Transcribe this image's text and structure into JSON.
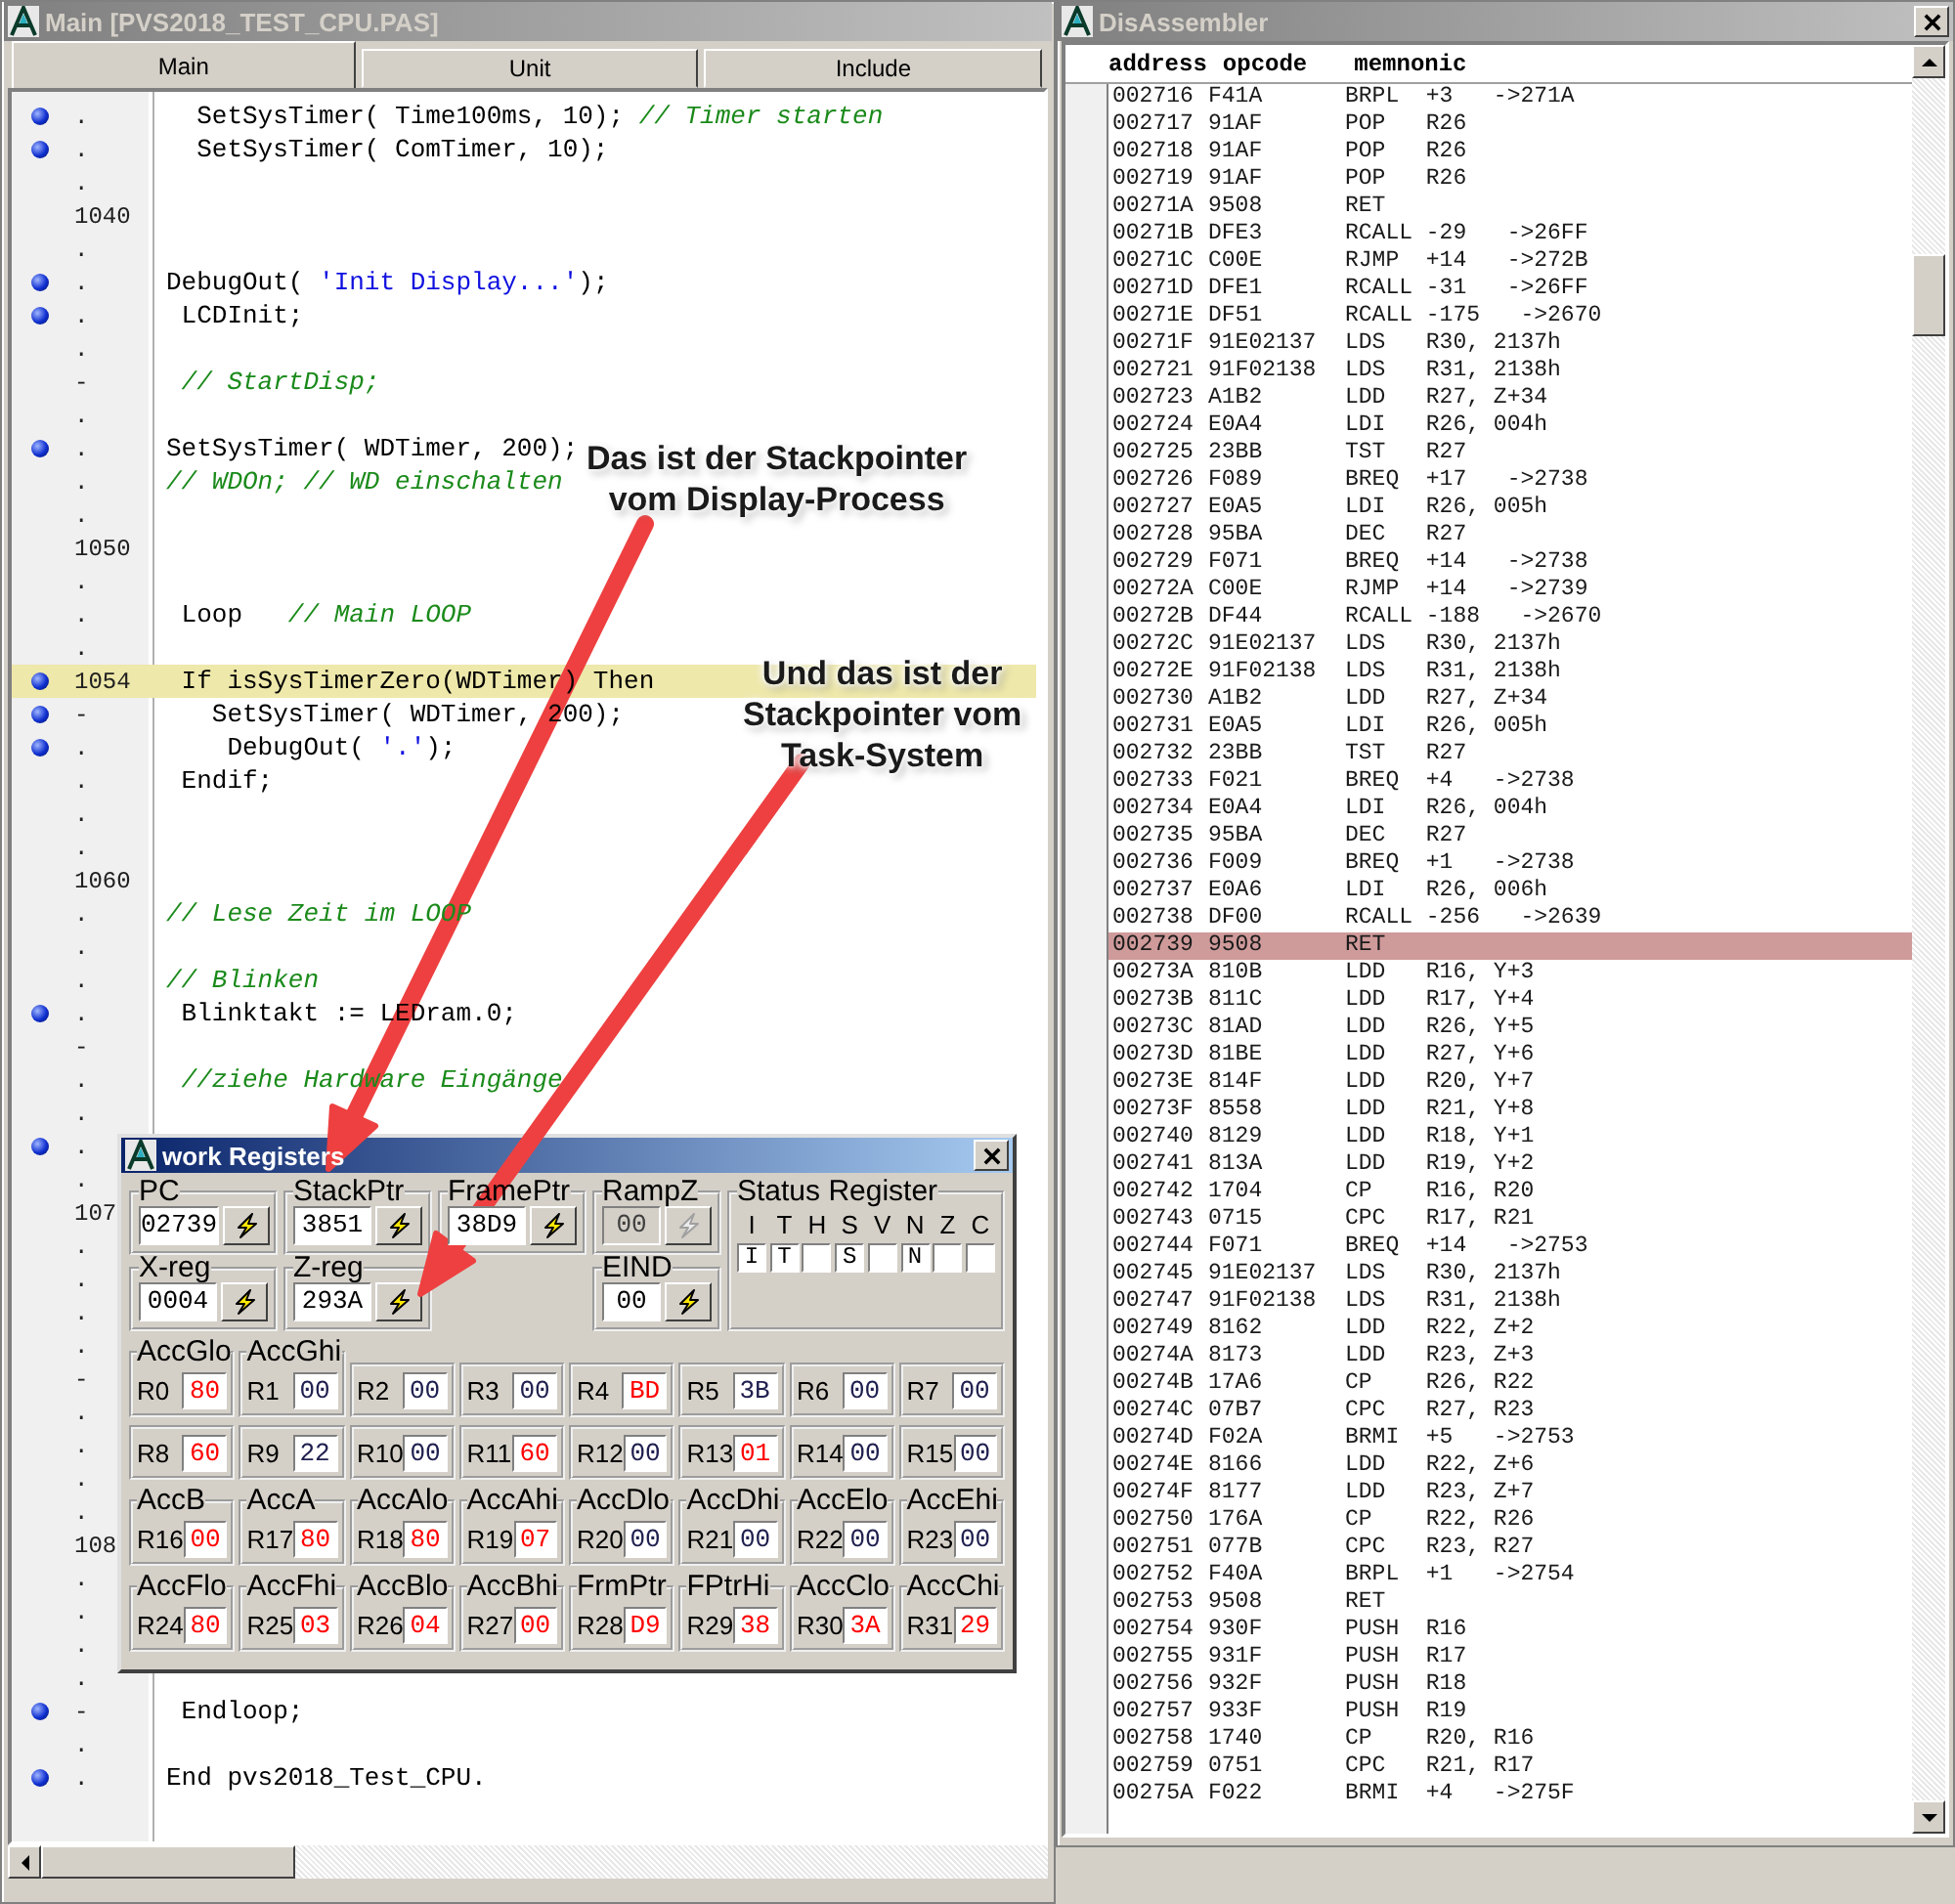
{
  "editor_window": {
    "title": "Main [PVS2018_TEST_CPU.PAS]",
    "tabs": [
      {
        "label": "Main",
        "selected": true
      },
      {
        "label": "Unit",
        "selected": false
      },
      {
        "label": "Include",
        "selected": false
      }
    ],
    "lines": [
      {
        "breakpoint": true,
        "gutter": ".",
        "current": false,
        "code": [
          {
            "kind": "code",
            "text": "  SetSysTimer( Time100ms, 10); "
          },
          {
            "kind": "comment",
            "text": "// Timer starten"
          }
        ]
      },
      {
        "breakpoint": true,
        "gutter": ".",
        "current": false,
        "code": [
          {
            "kind": "code",
            "text": "  SetSysTimer( ComTimer, 10);"
          }
        ]
      },
      {
        "breakpoint": false,
        "gutter": ".",
        "current": false
      },
      {
        "breakpoint": false,
        "gutter": "1040",
        "current": false
      },
      {
        "breakpoint": false,
        "gutter": ".",
        "current": false
      },
      {
        "breakpoint": true,
        "gutter": ".",
        "current": false,
        "code": [
          {
            "kind": "code",
            "text": "DebugOut( "
          },
          {
            "kind": "string",
            "text": "'Init Display...'"
          },
          {
            "kind": "code",
            "text": ");"
          }
        ]
      },
      {
        "breakpoint": true,
        "gutter": ".",
        "current": false,
        "code": [
          {
            "kind": "code",
            "text": " LCDInit;"
          }
        ]
      },
      {
        "breakpoint": false,
        "gutter": ".",
        "current": false
      },
      {
        "breakpoint": false,
        "gutter": "-",
        "current": false,
        "code": [
          {
            "kind": "comment",
            "text": " // StartDisp;"
          }
        ]
      },
      {
        "breakpoint": false,
        "gutter": ".",
        "current": false
      },
      {
        "breakpoint": true,
        "gutter": ".",
        "current": false,
        "code": [
          {
            "kind": "code",
            "text": "SetSysTimer( WDTimer, 200);"
          }
        ]
      },
      {
        "breakpoint": false,
        "gutter": ".",
        "current": false,
        "code": [
          {
            "kind": "comment",
            "text": "// WDOn; // WD einschalten"
          }
        ]
      },
      {
        "breakpoint": false,
        "gutter": ".",
        "current": false
      },
      {
        "breakpoint": false,
        "gutter": "1050",
        "current": false
      },
      {
        "breakpoint": false,
        "gutter": ".",
        "current": false
      },
      {
        "breakpoint": false,
        "gutter": ".",
        "current": false,
        "code": [
          {
            "kind": "code",
            "text": " Loop   "
          },
          {
            "kind": "comment",
            "text": "// Main LOOP"
          }
        ]
      },
      {
        "breakpoint": false,
        "gutter": ".",
        "current": false
      },
      {
        "breakpoint": true,
        "gutter": "1054",
        "current": true,
        "code": [
          {
            "kind": "code",
            "text": " If isSysTimerZero(WDTimer) Then"
          }
        ]
      },
      {
        "breakpoint": true,
        "gutter": "-",
        "current": false,
        "code": [
          {
            "kind": "code",
            "text": "   SetSysTimer( WDTimer, 200);"
          }
        ]
      },
      {
        "breakpoint": true,
        "gutter": ".",
        "current": false,
        "code": [
          {
            "kind": "code",
            "text": "    DebugOut( "
          },
          {
            "kind": "string",
            "text": "'.'"
          },
          {
            "kind": "code",
            "text": ");"
          }
        ]
      },
      {
        "breakpoint": false,
        "gutter": ".",
        "current": false,
        "code": [
          {
            "kind": "code",
            "text": " Endif;"
          }
        ]
      },
      {
        "breakpoint": false,
        "gutter": ".",
        "current": false
      },
      {
        "breakpoint": false,
        "gutter": ".",
        "current": false
      },
      {
        "breakpoint": false,
        "gutter": "1060",
        "current": false
      },
      {
        "breakpoint": false,
        "gutter": ".",
        "current": false,
        "code": [
          {
            "kind": "comment",
            "text": "// Lese Zeit im LOOP"
          }
        ]
      },
      {
        "breakpoint": false,
        "gutter": ".",
        "current": false
      },
      {
        "breakpoint": false,
        "gutter": ".",
        "current": false,
        "code": [
          {
            "kind": "comment",
            "text": "// Blinken"
          }
        ]
      },
      {
        "breakpoint": true,
        "gutter": ".",
        "current": false,
        "code": [
          {
            "kind": "code",
            "text": " Blinktakt := LEDram.0;"
          }
        ]
      },
      {
        "breakpoint": false,
        "gutter": "-",
        "current": false
      },
      {
        "breakpoint": false,
        "gutter": ".",
        "current": false,
        "code": [
          {
            "kind": "comment",
            "text": " //ziehe Hardware Eingänge"
          }
        ]
      },
      {
        "breakpoint": false,
        "gutter": ".",
        "current": false
      },
      {
        "breakpoint": true,
        "gutter": ".",
        "current": false
      },
      {
        "breakpoint": false,
        "gutter": ".",
        "current": false
      },
      {
        "breakpoint": false,
        "gutter": "107",
        "current": false
      },
      {
        "breakpoint": false,
        "gutter": ".",
        "current": false
      },
      {
        "breakpoint": false,
        "gutter": ".",
        "current": false
      },
      {
        "breakpoint": false,
        "gutter": ".",
        "current": false
      },
      {
        "breakpoint": false,
        "gutter": ".",
        "current": false
      },
      {
        "breakpoint": false,
        "gutter": "-",
        "current": false
      },
      {
        "breakpoint": false,
        "gutter": ".",
        "current": false
      },
      {
        "breakpoint": false,
        "gutter": ".",
        "current": false
      },
      {
        "breakpoint": false,
        "gutter": ".",
        "current": false
      },
      {
        "breakpoint": false,
        "gutter": ".",
        "current": false
      },
      {
        "breakpoint": false,
        "gutter": "108",
        "current": false
      },
      {
        "breakpoint": false,
        "gutter": ".",
        "current": false
      },
      {
        "breakpoint": false,
        "gutter": ".",
        "current": false
      },
      {
        "breakpoint": false,
        "gutter": ".",
        "current": false
      },
      {
        "breakpoint": false,
        "gutter": ".",
        "current": false
      },
      {
        "breakpoint": true,
        "gutter": "-",
        "current": false,
        "code": [
          {
            "kind": "code",
            "text": " Endloop;"
          }
        ]
      },
      {
        "breakpoint": false,
        "gutter": ".",
        "current": false
      },
      {
        "breakpoint": true,
        "gutter": ".",
        "current": false,
        "code": [
          {
            "kind": "code",
            "text": "End pvs2018_Test_CPU."
          }
        ]
      }
    ]
  },
  "disassembler_window": {
    "title": "DisAssembler",
    "columns": [
      "address",
      "opcode",
      "memnonic"
    ],
    "rows": [
      {
        "address": "002716",
        "opcode": "F41A",
        "mnemonic": "BRPL  +3   ->271A",
        "selected": false
      },
      {
        "address": "002717",
        "opcode": "91AF",
        "mnemonic": "POP   R26",
        "selected": false
      },
      {
        "address": "002718",
        "opcode": "91AF",
        "mnemonic": "POP   R26",
        "selected": false
      },
      {
        "address": "002719",
        "opcode": "91AF",
        "mnemonic": "POP   R26",
        "selected": false
      },
      {
        "address": "00271A",
        "opcode": "9508",
        "mnemonic": "RET",
        "selected": false
      },
      {
        "address": "00271B",
        "opcode": "DFE3",
        "mnemonic": "RCALL -29   ->26FF",
        "selected": false
      },
      {
        "address": "00271C",
        "opcode": "C00E",
        "mnemonic": "RJMP  +14   ->272B",
        "selected": false
      },
      {
        "address": "00271D",
        "opcode": "DFE1",
        "mnemonic": "RCALL -31   ->26FF",
        "selected": false
      },
      {
        "address": "00271E",
        "opcode": "DF51",
        "mnemonic": "RCALL -175   ->2670",
        "selected": false
      },
      {
        "address": "00271F",
        "opcode": "91E02137",
        "mnemonic": "LDS   R30, 2137h",
        "selected": false
      },
      {
        "address": "002721",
        "opcode": "91F02138",
        "mnemonic": "LDS   R31, 2138h",
        "selected": false
      },
      {
        "address": "002723",
        "opcode": "A1B2",
        "mnemonic": "LDD   R27, Z+34",
        "selected": false
      },
      {
        "address": "002724",
        "opcode": "E0A4",
        "mnemonic": "LDI   R26, 004h",
        "selected": false
      },
      {
        "address": "002725",
        "opcode": "23BB",
        "mnemonic": "TST   R27",
        "selected": false
      },
      {
        "address": "002726",
        "opcode": "F089",
        "mnemonic": "BREQ  +17   ->2738",
        "selected": false
      },
      {
        "address": "002727",
        "opcode": "E0A5",
        "mnemonic": "LDI   R26, 005h",
        "selected": false
      },
      {
        "address": "002728",
        "opcode": "95BA",
        "mnemonic": "DEC   R27",
        "selected": false
      },
      {
        "address": "002729",
        "opcode": "F071",
        "mnemonic": "BREQ  +14   ->2738",
        "selected": false
      },
      {
        "address": "00272A",
        "opcode": "C00E",
        "mnemonic": "RJMP  +14   ->2739",
        "selected": false
      },
      {
        "address": "00272B",
        "opcode": "DF44",
        "mnemonic": "RCALL -188   ->2670",
        "selected": false
      },
      {
        "address": "00272C",
        "opcode": "91E02137",
        "mnemonic": "LDS   R30, 2137h",
        "selected": false
      },
      {
        "address": "00272E",
        "opcode": "91F02138",
        "mnemonic": "LDS   R31, 2138h",
        "selected": false
      },
      {
        "address": "002730",
        "opcode": "A1B2",
        "mnemonic": "LDD   R27, Z+34",
        "selected": false
      },
      {
        "address": "002731",
        "opcode": "E0A5",
        "mnemonic": "LDI   R26, 005h",
        "selected": false
      },
      {
        "address": "002732",
        "opcode": "23BB",
        "mnemonic": "TST   R27",
        "selected": false
      },
      {
        "address": "002733",
        "opcode": "F021",
        "mnemonic": "BREQ  +4   ->2738",
        "selected": false
      },
      {
        "address": "002734",
        "opcode": "E0A4",
        "mnemonic": "LDI   R26, 004h",
        "selected": false
      },
      {
        "address": "002735",
        "opcode": "95BA",
        "mnemonic": "DEC   R27",
        "selected": false
      },
      {
        "address": "002736",
        "opcode": "F009",
        "mnemonic": "BREQ  +1   ->2738",
        "selected": false
      },
      {
        "address": "002737",
        "opcode": "E0A6",
        "mnemonic": "LDI   R26, 006h",
        "selected": false
      },
      {
        "address": "002738",
        "opcode": "DF00",
        "mnemonic": "RCALL -256   ->2639",
        "selected": false
      },
      {
        "address": "002739",
        "opcode": "9508",
        "mnemonic": "RET",
        "selected": true
      },
      {
        "address": "00273A",
        "opcode": "810B",
        "mnemonic": "LDD   R16, Y+3",
        "selected": false
      },
      {
        "address": "00273B",
        "opcode": "811C",
        "mnemonic": "LDD   R17, Y+4",
        "selected": false
      },
      {
        "address": "00273C",
        "opcode": "81AD",
        "mnemonic": "LDD   R26, Y+5",
        "selected": false
      },
      {
        "address": "00273D",
        "opcode": "81BE",
        "mnemonic": "LDD   R27, Y+6",
        "selected": false
      },
      {
        "address": "00273E",
        "opcode": "814F",
        "mnemonic": "LDD   R20, Y+7",
        "selected": false
      },
      {
        "address": "00273F",
        "opcode": "8558",
        "mnemonic": "LDD   R21, Y+8",
        "selected": false
      },
      {
        "address": "002740",
        "opcode": "8129",
        "mnemonic": "LDD   R18, Y+1",
        "selected": false
      },
      {
        "address": "002741",
        "opcode": "813A",
        "mnemonic": "LDD   R19, Y+2",
        "selected": false
      },
      {
        "address": "002742",
        "opcode": "1704",
        "mnemonic": "CP    R16, R20",
        "selected": false
      },
      {
        "address": "002743",
        "opcode": "0715",
        "mnemonic": "CPC   R17, R21",
        "selected": false
      },
      {
        "address": "002744",
        "opcode": "F071",
        "mnemonic": "BREQ  +14   ->2753",
        "selected": false
      },
      {
        "address": "002745",
        "opcode": "91E02137",
        "mnemonic": "LDS   R30, 2137h",
        "selected": false
      },
      {
        "address": "002747",
        "opcode": "91F02138",
        "mnemonic": "LDS   R31, 2138h",
        "selected": false
      },
      {
        "address": "002749",
        "opcode": "8162",
        "mnemonic": "LDD   R22, Z+2",
        "selected": false
      },
      {
        "address": "00274A",
        "opcode": "8173",
        "mnemonic": "LDD   R23, Z+3",
        "selected": false
      },
      {
        "address": "00274B",
        "opcode": "17A6",
        "mnemonic": "CP    R26, R22",
        "selected": false
      },
      {
        "address": "00274C",
        "opcode": "07B7",
        "mnemonic": "CPC   R27, R23",
        "selected": false
      },
      {
        "address": "00274D",
        "opcode": "F02A",
        "mnemonic": "BRMI  +5   ->2753",
        "selected": false
      },
      {
        "address": "00274E",
        "opcode": "8166",
        "mnemonic": "LDD   R22, Z+6",
        "selected": false
      },
      {
        "address": "00274F",
        "opcode": "8177",
        "mnemonic": "LDD   R23, Z+7",
        "selected": false
      },
      {
        "address": "002750",
        "opcode": "176A",
        "mnemonic": "CP    R22, R26",
        "selected": false
      },
      {
        "address": "002751",
        "opcode": "077B",
        "mnemonic": "CPC   R23, R27",
        "selected": false
      },
      {
        "address": "002752",
        "opcode": "F40A",
        "mnemonic": "BRPL  +1   ->2754",
        "selected": false
      },
      {
        "address": "002753",
        "opcode": "9508",
        "mnemonic": "RET",
        "selected": false
      },
      {
        "address": "002754",
        "opcode": "930F",
        "mnemonic": "PUSH  R16",
        "selected": false
      },
      {
        "address": "002755",
        "opcode": "931F",
        "mnemonic": "PUSH  R17",
        "selected": false
      },
      {
        "address": "002756",
        "opcode": "932F",
        "mnemonic": "PUSH  R18",
        "selected": false
      },
      {
        "address": "002757",
        "opcode": "933F",
        "mnemonic": "PUSH  R19",
        "selected": false
      },
      {
        "address": "002758",
        "opcode": "1740",
        "mnemonic": "CP    R20, R16",
        "selected": false
      },
      {
        "address": "002759",
        "opcode": "0751",
        "mnemonic": "CPC   R21, R17",
        "selected": false
      },
      {
        "address": "00275A",
        "opcode": "F022",
        "mnemonic": "BRMI  +4   ->275F",
        "selected": false
      }
    ]
  },
  "registers_window": {
    "title": "work Registers",
    "pointer_rows": [
      [
        {
          "label": "PC",
          "value": "02739",
          "enabled": true
        },
        {
          "label": "StackPtr",
          "value": "3851",
          "enabled": true
        },
        {
          "label": "FramePtr",
          "value": "38D9",
          "enabled": true
        },
        {
          "label": "RampZ",
          "value": "00",
          "enabled": false
        }
      ],
      [
        {
          "label": "X-reg",
          "value": "0004",
          "enabled": true
        },
        {
          "label": "Z-reg",
          "value": "293A",
          "enabled": true
        },
        {
          "label": "EIND",
          "value": "00",
          "enabled": true
        }
      ]
    ],
    "status_register": {
      "title": "Status Register",
      "flags": [
        {
          "label": "I",
          "box_text": "I"
        },
        {
          "label": "T",
          "box_text": "T"
        },
        {
          "label": "H"
        },
        {
          "label": "S",
          "box_text": "S"
        },
        {
          "label": "V"
        },
        {
          "label": "N",
          "box_text": "N"
        },
        {
          "label": "Z"
        },
        {
          "label": "C"
        }
      ]
    },
    "registers": [
      {
        "alias": "AccGlo",
        "name": "R0",
        "value": "80",
        "changed": true
      },
      {
        "alias": "AccGhi",
        "name": "R1",
        "value": "00",
        "changed": false
      },
      {
        "name": "R2",
        "value": "00",
        "changed": false
      },
      {
        "name": "R3",
        "value": "00",
        "changed": false
      },
      {
        "name": "R4",
        "value": "BD",
        "changed": true
      },
      {
        "name": "R5",
        "value": "3B",
        "changed": false
      },
      {
        "name": "R6",
        "value": "00",
        "changed": false
      },
      {
        "name": "R7",
        "value": "00",
        "changed": false
      },
      {
        "name": "R8",
        "value": "60",
        "changed": true
      },
      {
        "name": "R9",
        "value": "22",
        "changed": false
      },
      {
        "name": "R10",
        "value": "00",
        "changed": false
      },
      {
        "name": "R11",
        "value": "60",
        "changed": true
      },
      {
        "name": "R12",
        "value": "00",
        "changed": false
      },
      {
        "name": "R13",
        "value": "01",
        "changed": true
      },
      {
        "name": "R14",
        "value": "00",
        "changed": false
      },
      {
        "name": "R15",
        "value": "00",
        "changed": false
      },
      {
        "alias": "AccB",
        "name": "R16",
        "value": "00",
        "changed": true
      },
      {
        "alias": "AccA",
        "name": "R17",
        "value": "80",
        "changed": true
      },
      {
        "alias": "AccAlo",
        "name": "R18",
        "value": "80",
        "changed": true
      },
      {
        "alias": "AccAhi",
        "name": "R19",
        "value": "07",
        "changed": true
      },
      {
        "alias": "AccDlo",
        "name": "R20",
        "value": "00",
        "changed": false
      },
      {
        "alias": "AccDhi",
        "name": "R21",
        "value": "00",
        "changed": false
      },
      {
        "alias": "AccElo",
        "name": "R22",
        "value": "00",
        "changed": false
      },
      {
        "alias": "AccEhi",
        "name": "R23",
        "value": "00",
        "changed": false
      },
      {
        "alias": "AccFlo",
        "name": "R24",
        "value": "80",
        "changed": true
      },
      {
        "alias": "AccFhi",
        "name": "R25",
        "value": "03",
        "changed": true
      },
      {
        "alias": "AccBlo",
        "name": "R26",
        "value": "04",
        "changed": true
      },
      {
        "alias": "AccBhi",
        "name": "R27",
        "value": "00",
        "changed": true
      },
      {
        "alias": "FrmPtr",
        "name": "R28",
        "value": "D9",
        "changed": true
      },
      {
        "alias": "FPtrHi",
        "name": "R29",
        "value": "38",
        "changed": true
      },
      {
        "alias": "AccClo",
        "name": "R30",
        "value": "3A",
        "changed": true
      },
      {
        "alias": "AccChi",
        "name": "R31",
        "value": "29",
        "changed": true
      }
    ]
  },
  "callouts": [
    {
      "text": "Das ist der Stackpointer\nvom Display-Process"
    },
    {
      "text": "Und das ist der\nStackpointer vom\nTask-System"
    }
  ]
}
